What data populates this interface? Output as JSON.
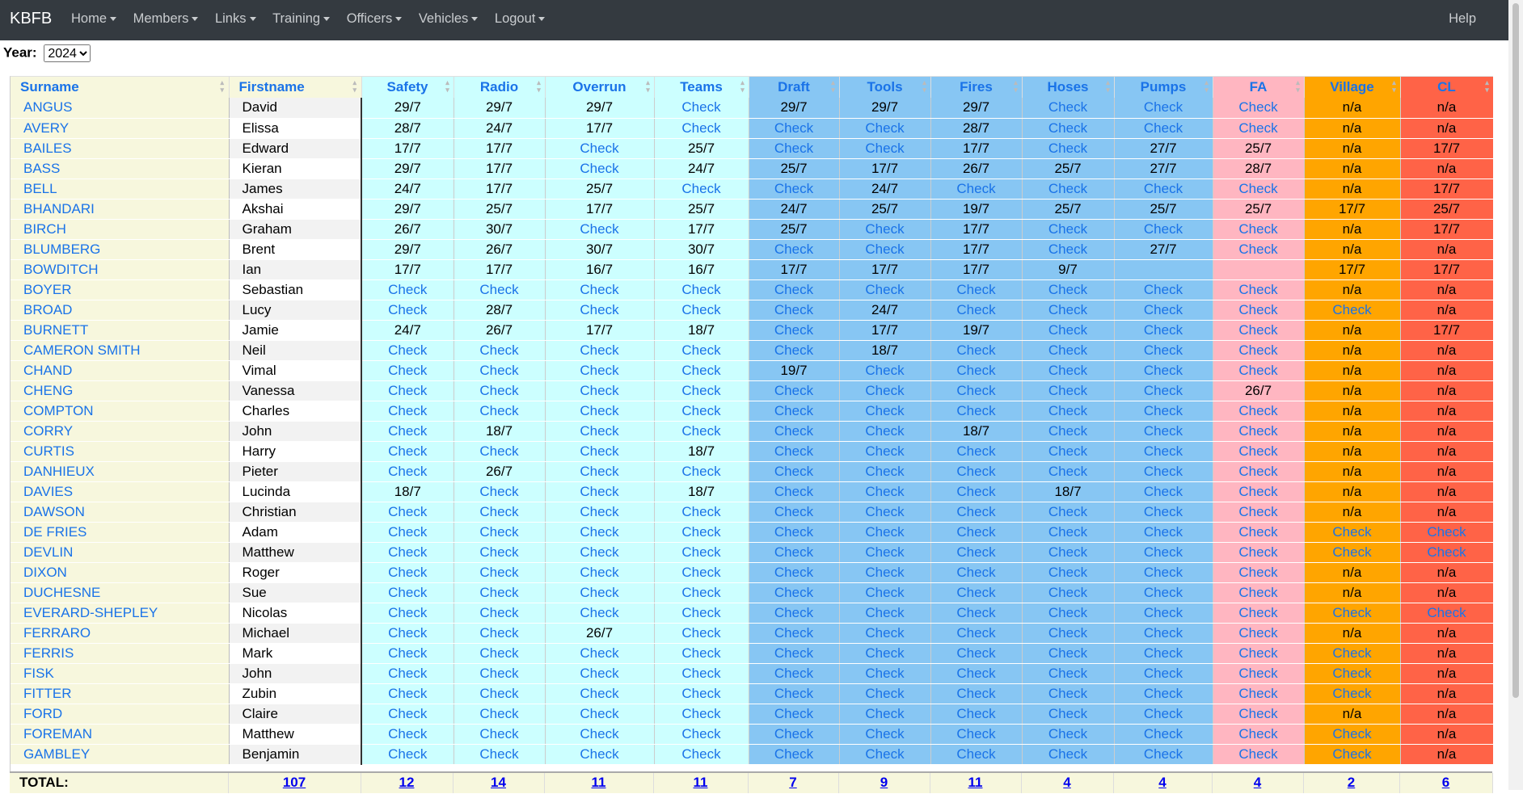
{
  "navbar": {
    "brand": "KBFB",
    "menus": [
      "Home",
      "Members",
      "Links",
      "Training",
      "Officers",
      "Vehicles",
      "Logout"
    ],
    "help": "Help"
  },
  "year": {
    "label": "Year:",
    "value": "2024"
  },
  "columns": [
    "Surname",
    "Firstname",
    "Safety",
    "Radio",
    "Overrun",
    "Teams",
    "Draft",
    "Tools",
    "Fires",
    "Hoses",
    "Pumps",
    "FA",
    "Village",
    "CL"
  ],
  "colors": {
    "cyan": "#ccffff",
    "blue": "#87c6f3",
    "pink": "#ffb6c1",
    "orange": "#ffa500",
    "red": "#ff6347",
    "surname_bg": "#f7f7dd",
    "link": "#1a73e8"
  },
  "rows": [
    {
      "surname": "ANGUS",
      "firstname": "David",
      "cells": [
        "29/7",
        "29/7",
        "29/7",
        "Check",
        "29/7",
        "29/7",
        "29/7",
        "Check",
        "Check",
        "Check",
        "n/a",
        "n/a"
      ]
    },
    {
      "surname": "AVERY",
      "firstname": "Elissa",
      "cells": [
        "28/7",
        "24/7",
        "17/7",
        "Check",
        "Check",
        "Check",
        "28/7",
        "Check",
        "Check",
        "Check",
        "n/a",
        "n/a"
      ]
    },
    {
      "surname": "BAILES",
      "firstname": "Edward",
      "cells": [
        "17/7",
        "17/7",
        "Check",
        "25/7",
        "Check",
        "Check",
        "17/7",
        "Check",
        "27/7",
        "25/7",
        "n/a",
        "17/7"
      ]
    },
    {
      "surname": "BASS",
      "firstname": "Kieran",
      "cells": [
        "29/7",
        "17/7",
        "Check",
        "24/7",
        "25/7",
        "17/7",
        "26/7",
        "25/7",
        "27/7",
        "28/7",
        "n/a",
        "n/a"
      ]
    },
    {
      "surname": "BELL",
      "firstname": "James",
      "cells": [
        "24/7",
        "17/7",
        "25/7",
        "Check",
        "Check",
        "24/7",
        "Check",
        "Check",
        "Check",
        "Check",
        "n/a",
        "17/7"
      ]
    },
    {
      "surname": "BHANDARI",
      "firstname": "Akshai",
      "cells": [
        "29/7",
        "25/7",
        "17/7",
        "25/7",
        "24/7",
        "25/7",
        "19/7",
        "25/7",
        "25/7",
        "25/7",
        "17/7",
        "25/7"
      ]
    },
    {
      "surname": "BIRCH",
      "firstname": "Graham",
      "cells": [
        "26/7",
        "30/7",
        "Check",
        "17/7",
        "25/7",
        "Check",
        "17/7",
        "Check",
        "Check",
        "Check",
        "n/a",
        "17/7"
      ]
    },
    {
      "surname": "BLUMBERG",
      "firstname": "Brent",
      "cells": [
        "29/7",
        "26/7",
        "30/7",
        "30/7",
        "Check",
        "Check",
        "17/7",
        "Check",
        "27/7",
        "Check",
        "n/a",
        "n/a"
      ]
    },
    {
      "surname": "BOWDITCH",
      "firstname": "Ian",
      "cells": [
        "17/7",
        "17/7",
        "16/7",
        "16/7",
        "17/7",
        "17/7",
        "17/7",
        "9/7",
        "",
        "",
        "17/7",
        "17/7"
      ]
    },
    {
      "surname": "BOYER",
      "firstname": "Sebastian",
      "cells": [
        "Check",
        "Check",
        "Check",
        "Check",
        "Check",
        "Check",
        "Check",
        "Check",
        "Check",
        "Check",
        "n/a",
        "n/a"
      ]
    },
    {
      "surname": "BROAD",
      "firstname": "Lucy",
      "cells": [
        "Check",
        "28/7",
        "Check",
        "Check",
        "Check",
        "24/7",
        "Check",
        "Check",
        "Check",
        "Check",
        "Check",
        "n/a"
      ]
    },
    {
      "surname": "BURNETT",
      "firstname": "Jamie",
      "cells": [
        "24/7",
        "26/7",
        "17/7",
        "18/7",
        "Check",
        "17/7",
        "19/7",
        "Check",
        "Check",
        "Check",
        "n/a",
        "17/7"
      ]
    },
    {
      "surname": "CAMERON SMITH",
      "firstname": "Neil",
      "cells": [
        "Check",
        "Check",
        "Check",
        "Check",
        "Check",
        "18/7",
        "Check",
        "Check",
        "Check",
        "Check",
        "n/a",
        "n/a"
      ]
    },
    {
      "surname": "CHAND",
      "firstname": "Vimal",
      "cells": [
        "Check",
        "Check",
        "Check",
        "Check",
        "19/7",
        "Check",
        "Check",
        "Check",
        "Check",
        "Check",
        "n/a",
        "n/a"
      ]
    },
    {
      "surname": "CHENG",
      "firstname": "Vanessa",
      "cells": [
        "Check",
        "Check",
        "Check",
        "Check",
        "Check",
        "Check",
        "Check",
        "Check",
        "Check",
        "26/7",
        "n/a",
        "n/a"
      ]
    },
    {
      "surname": "COMPTON",
      "firstname": "Charles",
      "cells": [
        "Check",
        "Check",
        "Check",
        "Check",
        "Check",
        "Check",
        "Check",
        "Check",
        "Check",
        "Check",
        "n/a",
        "n/a"
      ]
    },
    {
      "surname": "CORRY",
      "firstname": "John",
      "cells": [
        "Check",
        "18/7",
        "Check",
        "Check",
        "Check",
        "Check",
        "18/7",
        "Check",
        "Check",
        "Check",
        "n/a",
        "n/a"
      ]
    },
    {
      "surname": "CURTIS",
      "firstname": "Harry",
      "cells": [
        "Check",
        "Check",
        "Check",
        "18/7",
        "Check",
        "Check",
        "Check",
        "Check",
        "Check",
        "Check",
        "n/a",
        "n/a"
      ]
    },
    {
      "surname": "DANHIEUX",
      "firstname": "Pieter",
      "cells": [
        "Check",
        "26/7",
        "Check",
        "Check",
        "Check",
        "Check",
        "Check",
        "Check",
        "Check",
        "Check",
        "n/a",
        "n/a"
      ]
    },
    {
      "surname": "DAVIES",
      "firstname": "Lucinda",
      "cells": [
        "18/7",
        "Check",
        "Check",
        "18/7",
        "Check",
        "Check",
        "Check",
        "18/7",
        "Check",
        "Check",
        "n/a",
        "n/a"
      ]
    },
    {
      "surname": "DAWSON",
      "firstname": "Christian",
      "cells": [
        "Check",
        "Check",
        "Check",
        "Check",
        "Check",
        "Check",
        "Check",
        "Check",
        "Check",
        "Check",
        "n/a",
        "n/a"
      ]
    },
    {
      "surname": "DE FRIES",
      "firstname": "Adam",
      "cells": [
        "Check",
        "Check",
        "Check",
        "Check",
        "Check",
        "Check",
        "Check",
        "Check",
        "Check",
        "Check",
        "Check",
        "Check"
      ]
    },
    {
      "surname": "DEVLIN",
      "firstname": "Matthew",
      "cells": [
        "Check",
        "Check",
        "Check",
        "Check",
        "Check",
        "Check",
        "Check",
        "Check",
        "Check",
        "Check",
        "Check",
        "Check"
      ]
    },
    {
      "surname": "DIXON",
      "firstname": "Roger",
      "cells": [
        "Check",
        "Check",
        "Check",
        "Check",
        "Check",
        "Check",
        "Check",
        "Check",
        "Check",
        "Check",
        "n/a",
        "n/a"
      ]
    },
    {
      "surname": "DUCHESNE",
      "firstname": "Sue",
      "cells": [
        "Check",
        "Check",
        "Check",
        "Check",
        "Check",
        "Check",
        "Check",
        "Check",
        "Check",
        "Check",
        "n/a",
        "n/a"
      ]
    },
    {
      "surname": "EVERARD-SHEPLEY",
      "firstname": "Nicolas",
      "cells": [
        "Check",
        "Check",
        "Check",
        "Check",
        "Check",
        "Check",
        "Check",
        "Check",
        "Check",
        "Check",
        "Check",
        "Check"
      ]
    },
    {
      "surname": "FERRARO",
      "firstname": "Michael",
      "cells": [
        "Check",
        "Check",
        "26/7",
        "Check",
        "Check",
        "Check",
        "Check",
        "Check",
        "Check",
        "Check",
        "n/a",
        "n/a"
      ]
    },
    {
      "surname": "FERRIS",
      "firstname": "Mark",
      "cells": [
        "Check",
        "Check",
        "Check",
        "Check",
        "Check",
        "Check",
        "Check",
        "Check",
        "Check",
        "Check",
        "Check",
        "n/a"
      ]
    },
    {
      "surname": "FISK",
      "firstname": "John",
      "cells": [
        "Check",
        "Check",
        "Check",
        "Check",
        "Check",
        "Check",
        "Check",
        "Check",
        "Check",
        "Check",
        "Check",
        "n/a"
      ]
    },
    {
      "surname": "FITTER",
      "firstname": "Zubin",
      "cells": [
        "Check",
        "Check",
        "Check",
        "Check",
        "Check",
        "Check",
        "Check",
        "Check",
        "Check",
        "Check",
        "Check",
        "n/a"
      ]
    },
    {
      "surname": "FORD",
      "firstname": "Claire",
      "cells": [
        "Check",
        "Check",
        "Check",
        "Check",
        "Check",
        "Check",
        "Check",
        "Check",
        "Check",
        "Check",
        "n/a",
        "n/a"
      ]
    },
    {
      "surname": "FOREMAN",
      "firstname": "Matthew",
      "cells": [
        "Check",
        "Check",
        "Check",
        "Check",
        "Check",
        "Check",
        "Check",
        "Check",
        "Check",
        "Check",
        "Check",
        "n/a"
      ]
    },
    {
      "surname": "GAMBLEY",
      "firstname": "Benjamin",
      "cells": [
        "Check",
        "Check",
        "Check",
        "Check",
        "Check",
        "Check",
        "Check",
        "Check",
        "Check",
        "Check",
        "Check",
        "n/a"
      ]
    }
  ],
  "totals": {
    "label": "TOTAL:",
    "values": [
      "107",
      "12",
      "14",
      "11",
      "11",
      "7",
      "9",
      "11",
      "4",
      "4",
      "4",
      "2",
      "6"
    ]
  }
}
